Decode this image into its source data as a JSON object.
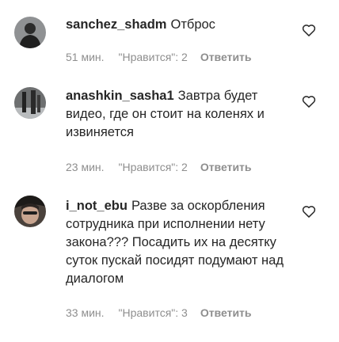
{
  "comments": [
    {
      "username": "sanchez_shadm",
      "text": "Отброс",
      "time": "51 мин.",
      "likes": "\"Нравится\": 2",
      "reply": "Ответить"
    },
    {
      "username": "anashkin_sasha1",
      "text": "Завтра будет видео, где он стоит на коленях и извиняется",
      "time": "23 мин.",
      "likes": "\"Нравится\": 2",
      "reply": "Ответить"
    },
    {
      "username": "i_not_ebu",
      "text": "Разве за оскорбления сотрудника при исполнении нету закона??? Посадить их на десятку суток пускай посидят подумают над диалогом",
      "time": "33 мин.",
      "likes": "\"Нравится\": 3",
      "reply": "Ответить"
    }
  ],
  "icons": {
    "like": "heart-outline-icon",
    "avatar": "user-avatar"
  },
  "colors": {
    "text": "#262626",
    "meta": "#8e8e8e"
  }
}
